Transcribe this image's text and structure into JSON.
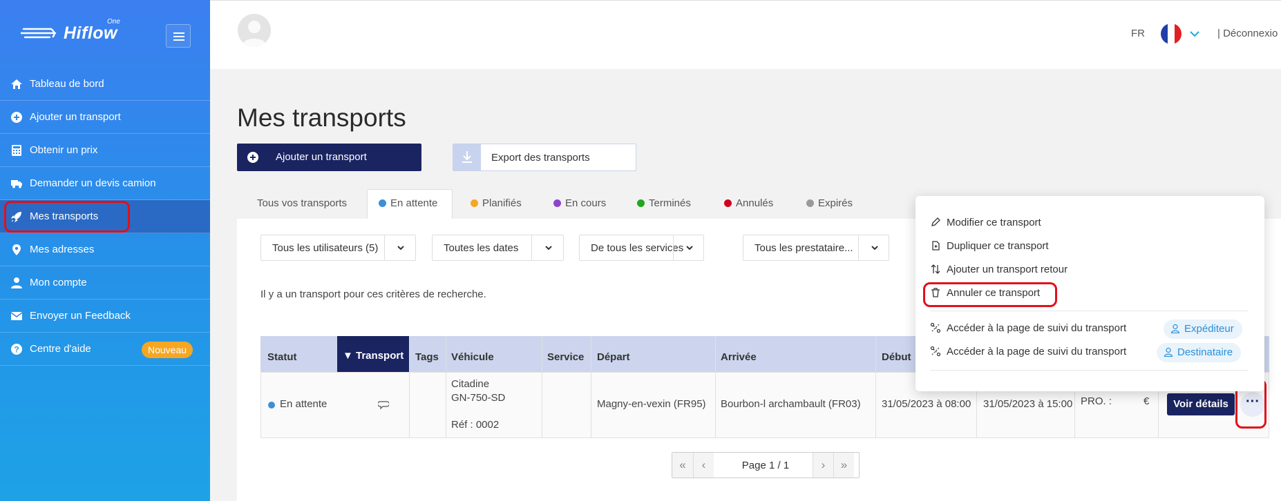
{
  "app": {
    "logo_text": "Hiflow",
    "logo_sup": "One"
  },
  "sidebar": {
    "items": [
      {
        "label": "Tableau de bord",
        "icon": "home-icon"
      },
      {
        "label": "Ajouter un transport",
        "icon": "plus-circle-icon"
      },
      {
        "label": "Obtenir un prix",
        "icon": "calculator-icon"
      },
      {
        "label": "Demander un devis camion",
        "icon": "truck-icon"
      },
      {
        "label": "Mes transports",
        "icon": "rocket-icon",
        "active": true
      },
      {
        "label": "Mes adresses",
        "icon": "map-pin-icon"
      },
      {
        "label": "Mon compte",
        "icon": "user-icon"
      },
      {
        "label": "Envoyer un Feedback",
        "icon": "envelope-icon"
      },
      {
        "label": "Centre d'aide",
        "icon": "help-icon",
        "badge": "Nouveau"
      }
    ]
  },
  "header": {
    "lang": "FR",
    "logout": "| Déconnexio"
  },
  "main": {
    "title": "Mes transports",
    "add_button": "Ajouter un transport",
    "export_button": "Export des transports",
    "tabs": [
      {
        "label": "Tous vos transports",
        "dot": ""
      },
      {
        "label": "En attente",
        "dot": "#3d8fd6"
      },
      {
        "label": "Planifiés",
        "dot": "#f5a623"
      },
      {
        "label": "En cours",
        "dot": "#8e44cc"
      },
      {
        "label": "Terminés",
        "dot": "#1fa81f"
      },
      {
        "label": "Annulés",
        "dot": "#d0021b"
      },
      {
        "label": "Expirés",
        "dot": "#999999"
      }
    ],
    "filters": [
      "Tous les utilisateurs (5)",
      "Toutes les dates",
      "De tous les services",
      "Tous les prestataire..."
    ],
    "info_text": "Il y a un transport pour ces critères de recherche."
  },
  "table": {
    "headers": [
      "Statut",
      "▼ Transport",
      "Tags",
      "Véhicule",
      "Service",
      "Départ",
      "Arrivée",
      "Début"
    ],
    "row": {
      "status": "En attente",
      "vehicle_line1": "Citadine",
      "vehicle_line2": "GN-750-SD",
      "vehicle_ref": "Réf : 0002",
      "depart": "Magny-en-vexin (FR95)",
      "arrivee": "Bourbon-l archambault (FR03)",
      "debut": "31/05/2023 à 08:00",
      "fin": "31/05/2023 à 15:00",
      "price_prefix": "PRO. :",
      "price_suffix": "€",
      "action": "Voir détails",
      "more": "···"
    }
  },
  "pagination": {
    "label": "Page 1 / 1"
  },
  "dropdown": {
    "items": [
      {
        "label": "Modifier ce transport",
        "icon": "pencil-icon"
      },
      {
        "label": "Dupliquer ce transport",
        "icon": "duplicate-icon"
      },
      {
        "label": "Ajouter un transport retour",
        "icon": "swap-arrows-icon"
      },
      {
        "label": "Annuler ce transport",
        "icon": "trash-icon"
      }
    ],
    "tracking": [
      {
        "label": "Accéder à la page de suivi du transport",
        "chip": "Expéditeur"
      },
      {
        "label": "Accéder à la page de suivi du transport",
        "chip": "Destinataire"
      }
    ]
  },
  "colors": {
    "sidebar_top": "#3b7ff0",
    "sidebar_bottom": "#1ea2e6",
    "navy": "#1a2461",
    "annotation": "#e0101a",
    "badge": "#f5a623"
  }
}
